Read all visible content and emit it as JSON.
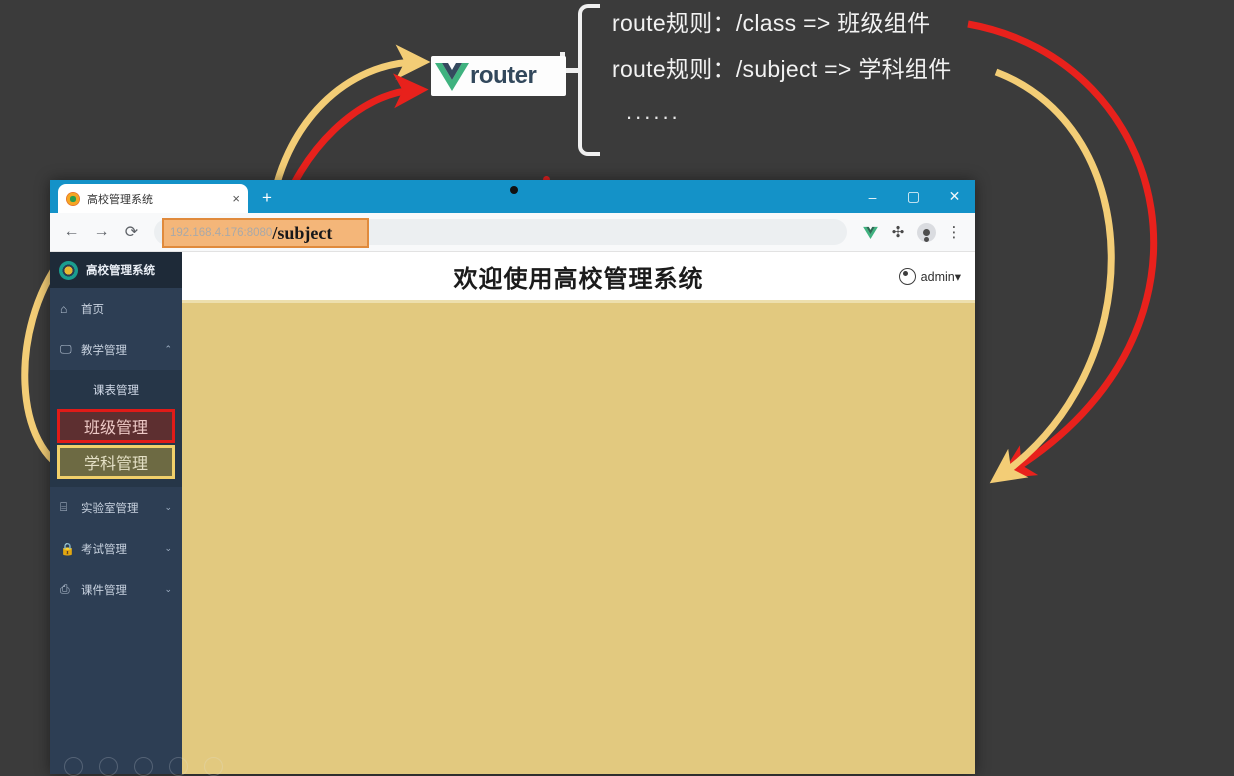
{
  "annotation": {
    "lines": [
      "route规则：/class =>  班级组件",
      "route规则：/subject => 学科组件"
    ],
    "ellipsis": "......",
    "logo": {
      "mark": "vue-logo-icon",
      "text": "router"
    }
  },
  "browser": {
    "tab": {
      "favicon": "site-favicon-icon",
      "title": "高校管理系统",
      "close": "×"
    },
    "new_tab": "+",
    "window_controls": {
      "minimize": "–",
      "maximize": "▢",
      "close": "✕"
    },
    "toolbar": {
      "back": "←",
      "forward": "→",
      "reload": "⟳",
      "vue_devtools": "vue-devtools-icon",
      "extensions": "puzzle-icon",
      "profile": "profile-avatar-icon",
      "menu": "⋮"
    },
    "url": {
      "host": "192.168.4.176:8080",
      "path": "/subject"
    }
  },
  "app": {
    "brand": {
      "logo": "app-logo-icon",
      "name": "高校管理系统"
    },
    "nav": [
      {
        "icon": "home-icon",
        "glyph": "⌂",
        "label": "首页",
        "chevron": ""
      },
      {
        "icon": "monitor-icon",
        "glyph": "🖵",
        "label": "教学管理",
        "chevron": "⌃"
      }
    ],
    "submenu": [
      {
        "label": "课表管理",
        "highlight": "none"
      },
      {
        "label": "班级管理",
        "highlight": "red"
      },
      {
        "label": "学科管理",
        "highlight": "yellow"
      }
    ],
    "nav_bottom": [
      {
        "icon": "lab-icon",
        "glyph": "⌸",
        "label": "实验室管理",
        "chevron": "⌄"
      },
      {
        "icon": "lock-icon",
        "glyph": "🔒",
        "label": "考试管理",
        "chevron": "⌄"
      },
      {
        "icon": "courseware-icon",
        "glyph": "⎙",
        "label": "课件管理",
        "chevron": "⌄"
      }
    ],
    "header": {
      "welcome": "欢迎使用高校管理系统",
      "user": "admin▾",
      "user_icon": "user-circle-icon"
    }
  },
  "colors": {
    "titlebar": "#1492c8",
    "sidebar": "#2d3e54",
    "content": "#e2c97f",
    "highlight_red": "#e01b18",
    "highlight_yellow": "#f1d06a",
    "url_chip": "#f4b679",
    "arrow_red": "#e8211c",
    "arrow_yellow": "#f3cd76"
  }
}
